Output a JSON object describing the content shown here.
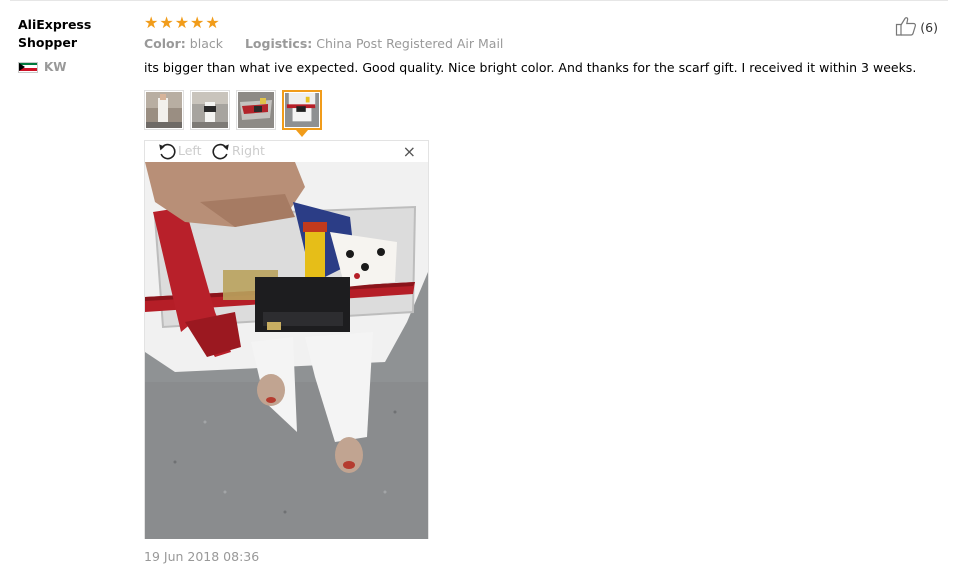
{
  "reviewer": {
    "name_line1": "AliExpress",
    "name_line2": "Shopper",
    "country_code": "KW",
    "flag_icon": "kuwait-flag-icon"
  },
  "review": {
    "rating": 5,
    "star_color": "#f19c1a",
    "color_label": "Color:",
    "color_value": "black",
    "logistics_label": "Logistics:",
    "logistics_value": "China Post Registered Air Mail",
    "text": "its bigger than what ive expected. Good quality. Nice bright color. And thanks for the scarf gift. I received it within 3 weeks.",
    "date": "19 Jun 2018 08:36"
  },
  "helpful": {
    "icon": "thumbs-up-icon",
    "count": "(6)"
  },
  "thumbnails": [
    {
      "name": "review-photo-1",
      "active": false
    },
    {
      "name": "review-photo-2",
      "active": false
    },
    {
      "name": "review-photo-3",
      "active": false
    },
    {
      "name": "review-photo-4",
      "active": true
    }
  ],
  "viewer": {
    "rotate_left_label": "Left",
    "rotate_right_label": "Right",
    "close_label": "×"
  }
}
